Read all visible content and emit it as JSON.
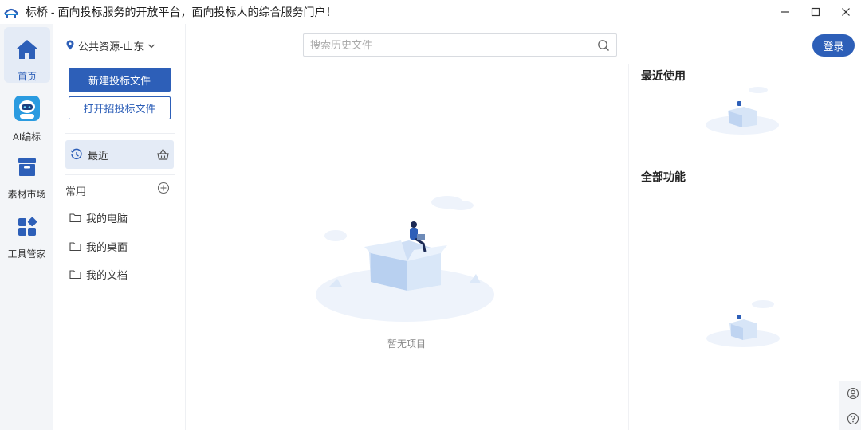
{
  "titlebar": {
    "title": "标桥 - 面向投标服务的开放平台，面向投标人的综合服务门户！",
    "logo_icon": "bridge-logo-icon",
    "controls": [
      "minimize-icon",
      "maximize-icon",
      "close-icon"
    ]
  },
  "nav": {
    "items": [
      {
        "label": "首页",
        "icon": "home-icon",
        "active": true
      },
      {
        "label": "AI编标",
        "icon": "robot-icon",
        "active": false
      },
      {
        "label": "素材市场",
        "icon": "archive-box-icon",
        "active": false
      },
      {
        "label": "工具管家",
        "icon": "grid-apps-icon",
        "active": false
      }
    ]
  },
  "sidebar": {
    "region": "公共资源-山东",
    "new_button": "新建投标文件",
    "open_button": "打开招投标文件",
    "recent_label": "最近",
    "common_label": "常用",
    "folders": [
      "我的电脑",
      "我的桌面",
      "我的文档"
    ]
  },
  "search": {
    "placeholder": "搜索历史文件",
    "value": ""
  },
  "header": {
    "login_label": "登录"
  },
  "main": {
    "empty_text": "暂无项目"
  },
  "right_panel": {
    "recent_title": "最近使用",
    "all_features_title": "全部功能"
  },
  "colors": {
    "accent": "#2d5fb8",
    "nav_bg": "#f3f5f8",
    "active_bg": "#e4ebf6"
  }
}
